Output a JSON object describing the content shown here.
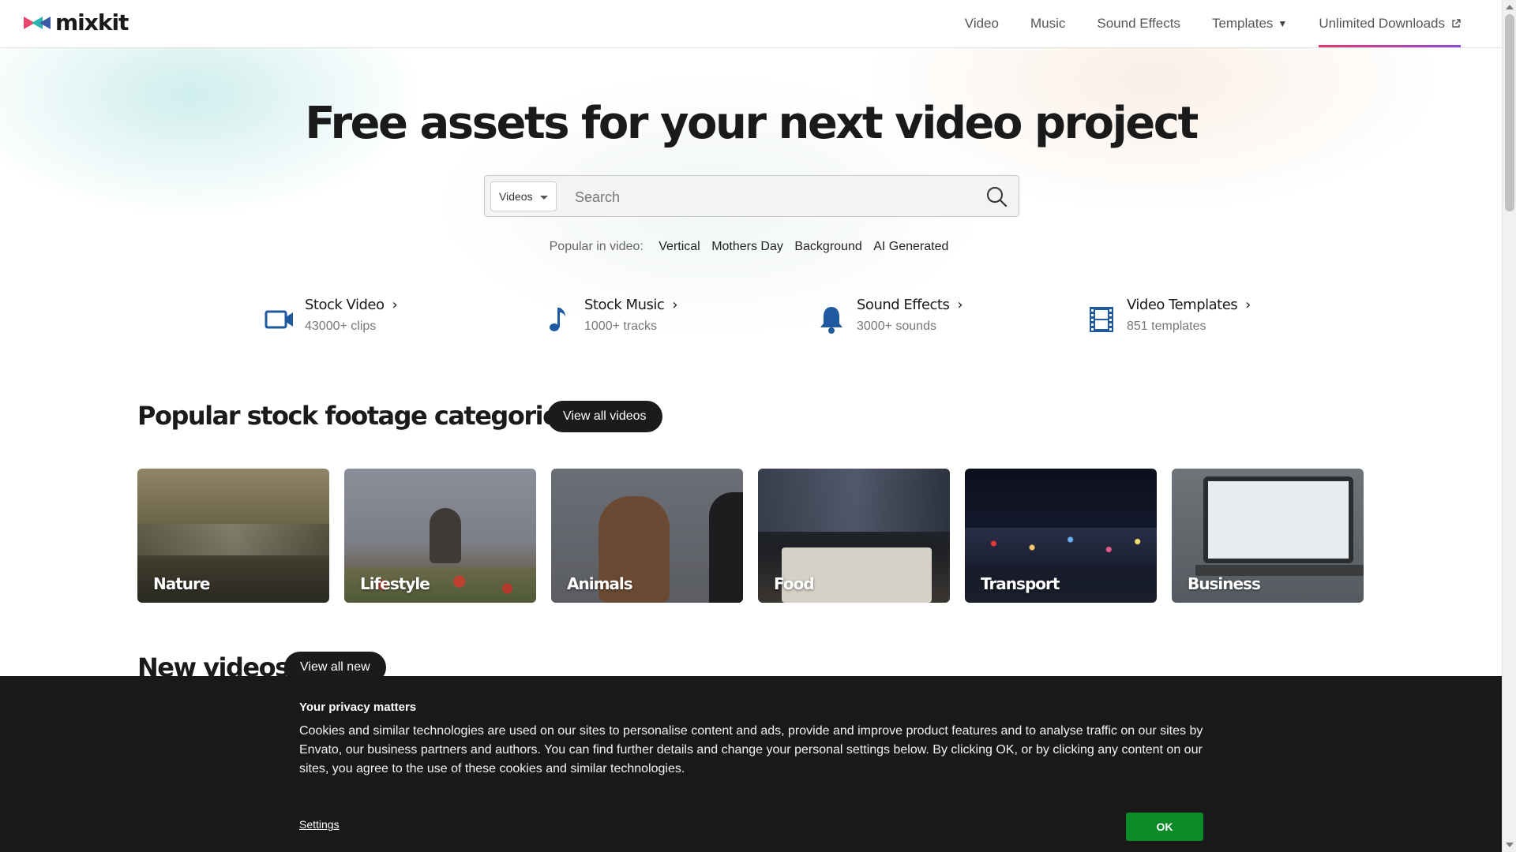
{
  "header": {
    "logo_text": "mixkit",
    "nav": [
      {
        "label": "Video"
      },
      {
        "label": "Music"
      },
      {
        "label": "Sound Effects"
      },
      {
        "label": "Templates"
      },
      {
        "label": "Unlimited Downloads"
      }
    ]
  },
  "hero": {
    "title": "Free assets for your next video project",
    "search": {
      "category": "Videos",
      "placeholder": "Search",
      "icon": "search-icon"
    },
    "popular": {
      "label": "Popular in video:",
      "tags": [
        "Vertical",
        "Mothers Day",
        "Background",
        "AI Generated"
      ]
    }
  },
  "quick_links": [
    {
      "title": "Stock Video",
      "subtitle": "43000+ clips",
      "icon": "video-camera-icon"
    },
    {
      "title": "Stock Music",
      "subtitle": "1000+ tracks",
      "icon": "music-note-icon"
    },
    {
      "title": "Sound Effects",
      "subtitle": "3000+ sounds",
      "icon": "bell-icon"
    },
    {
      "title": "Video Templates",
      "subtitle": "851 templates",
      "icon": "film-strip-icon"
    }
  ],
  "categories_section": {
    "title": "Popular stock footage categories",
    "button": "View all videos",
    "cards": [
      {
        "label": "Nature"
      },
      {
        "label": "Lifestyle"
      },
      {
        "label": "Animals"
      },
      {
        "label": "Food"
      },
      {
        "label": "Transport"
      },
      {
        "label": "Business"
      }
    ]
  },
  "new_videos_section": {
    "title": "New videos",
    "button": "View all new"
  },
  "cookie_banner": {
    "title": "Your privacy matters",
    "text": "Cookies and similar technologies are used on our sites to personalise content and ads, provide and improve product features and to analyse traffic on our sites by Envato, our business partners and authors. You can find further details and change your personal settings below. By clicking OK, or by clicking any content on our sites, you agree to the use of these cookies and similar technologies.",
    "settings_label": "Settings",
    "ok_label": "OK"
  },
  "colors": {
    "accent_icon": "#1f5aa0",
    "ok_button": "#0b8a28",
    "dark_pill": "#1b1b1b"
  }
}
